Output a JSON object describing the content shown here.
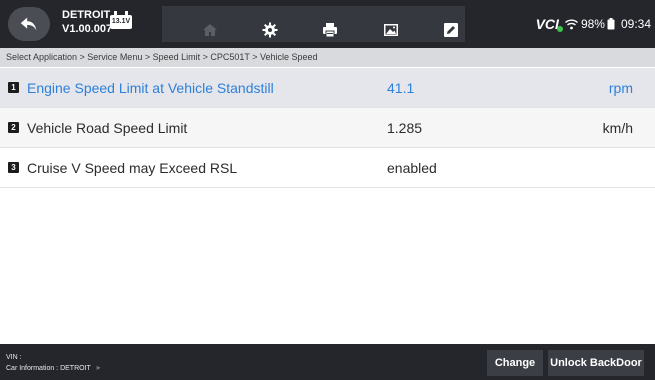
{
  "header": {
    "brand": "DETROIT",
    "version": "V1.00.007",
    "voltage": "13.1V",
    "toolbar_icons": [
      "home-icon",
      "gear-icon",
      "printer-icon",
      "image-icon",
      "edit-icon"
    ],
    "vci_label": "VCI",
    "battery_percent": "98%",
    "time": "09:34"
  },
  "breadcrumb": "Select Application > Service Menu > Speed Limit > CPC501T > Vehicle Speed",
  "rows": [
    {
      "num": "1",
      "name": "Engine Speed Limit at Vehicle Standstill",
      "value": "41.1",
      "unit": "rpm"
    },
    {
      "num": "2",
      "name": "Vehicle Road Speed Limit",
      "value": "1.285",
      "unit": "km/h"
    },
    {
      "num": "3",
      "name": "Cruise V Speed may Exceed RSL",
      "value": "enabled",
      "unit": ""
    }
  ],
  "footer": {
    "vin_label": "VIN :",
    "car_info": "Car Information : DETROIT",
    "change_label": "Change",
    "unlock_label": "Unlock BackDoor"
  }
}
